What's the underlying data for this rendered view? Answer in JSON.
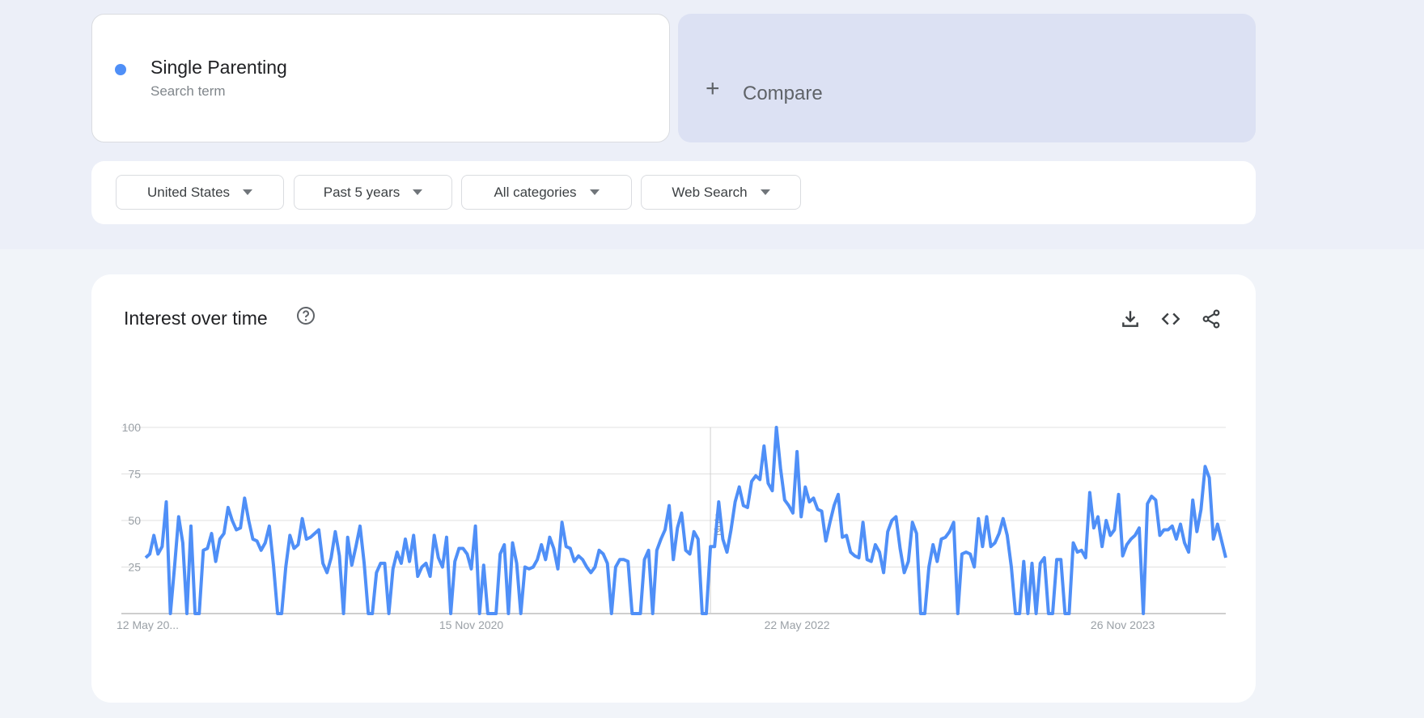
{
  "search_term": {
    "name": "Single Parenting",
    "subtitle": "Search term",
    "color": "#4f8ff7"
  },
  "compare": {
    "icon": "plus-icon",
    "plus": "+",
    "label": "Compare"
  },
  "filters": [
    {
      "label": "United States"
    },
    {
      "label": "Past 5 years"
    },
    {
      "label": "All categories"
    },
    {
      "label": "Web Search"
    }
  ],
  "panel": {
    "title": "Interest over time",
    "help_icon": "help-circle-icon",
    "actions": [
      "download-icon",
      "embed-code-icon",
      "share-icon"
    ],
    "note_label": "Note"
  },
  "chart_data": {
    "type": "line",
    "title": "",
    "xlabel": "",
    "ylabel": "",
    "ylim": [
      0,
      100
    ],
    "y_ticks": [
      25,
      50,
      75,
      100
    ],
    "x_tick_labels": [
      "12 May 20...",
      "15 Nov 2020",
      "22 May 2022",
      "26 Nov 2023"
    ],
    "grid": true,
    "series": [
      {
        "color": "#4f8ff7",
        "values": [
          30,
          32,
          42,
          32,
          36,
          60,
          0,
          25,
          52,
          38,
          0,
          47,
          0,
          0,
          34,
          35,
          43,
          28,
          40,
          43,
          57,
          50,
          45,
          46,
          62,
          50,
          40,
          39,
          34,
          38,
          47,
          26,
          0,
          0,
          25,
          42,
          35,
          37,
          51,
          40,
          41,
          43,
          45,
          27,
          22,
          30,
          44,
          31,
          0,
          41,
          26,
          36,
          47,
          27,
          0,
          0,
          22,
          27,
          27,
          0,
          24,
          33,
          27,
          40,
          28,
          42,
          20,
          25,
          27,
          20,
          42,
          30,
          25,
          41,
          0,
          28,
          35,
          35,
          32,
          24,
          47,
          0,
          26,
          0,
          0,
          0,
          32,
          37,
          0,
          38,
          27,
          0,
          25,
          24,
          25,
          29,
          37,
          29,
          41,
          35,
          24,
          49,
          36,
          35,
          28,
          31,
          29,
          25,
          22,
          25,
          34,
          32,
          27,
          0,
          25,
          29,
          29,
          28,
          0,
          0,
          0,
          29,
          34,
          0,
          34,
          40,
          45,
          58,
          29,
          46,
          54,
          34,
          32,
          44,
          40,
          0,
          0,
          36,
          36,
          60,
          40,
          33,
          45,
          60,
          68,
          58,
          57,
          71,
          74,
          72,
          90,
          70,
          66,
          100,
          78,
          61,
          58,
          54,
          87,
          52,
          68,
          60,
          62,
          56,
          55,
          39,
          49,
          58,
          64,
          41,
          42,
          33,
          31,
          30,
          49,
          29,
          28,
          37,
          33,
          22,
          44,
          50,
          52,
          35,
          22,
          28,
          49,
          43,
          0,
          0,
          25,
          37,
          28,
          40,
          41,
          44,
          49,
          0,
          32,
          33,
          32,
          25,
          51,
          36,
          52,
          36,
          38,
          43,
          51,
          42,
          25,
          0,
          0,
          28,
          0,
          27,
          0,
          27,
          30,
          0,
          0,
          29,
          29,
          0,
          0,
          38,
          33,
          34,
          30,
          65,
          46,
          52,
          36,
          50,
          42,
          45,
          64,
          31,
          37,
          40,
          42,
          46,
          0,
          59,
          63,
          61,
          42,
          45,
          45,
          47,
          40,
          48,
          38,
          33,
          61,
          44,
          56,
          79,
          73,
          40,
          48,
          39,
          30
        ]
      }
    ]
  }
}
